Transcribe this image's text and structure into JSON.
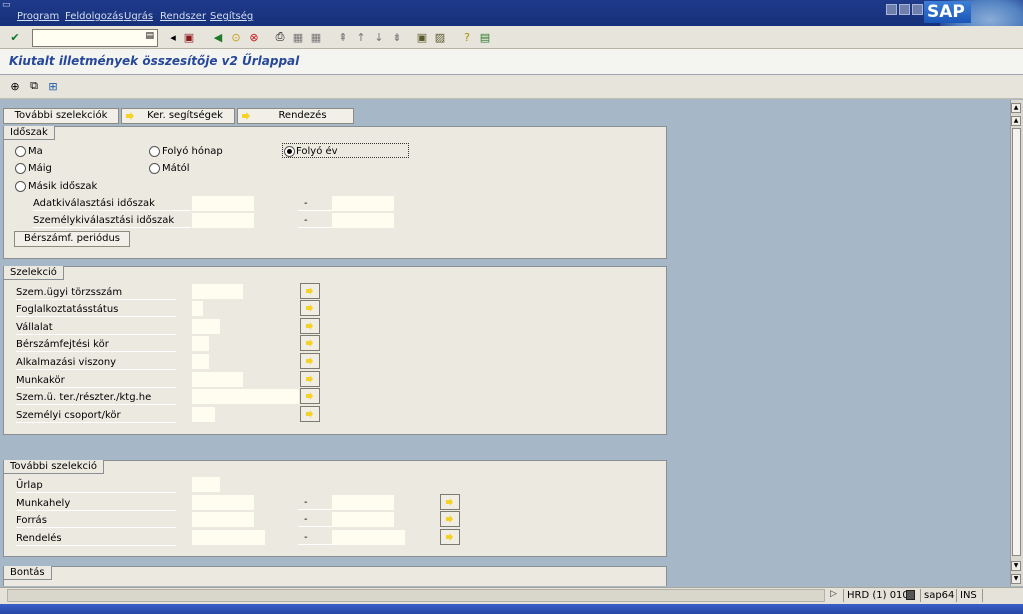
{
  "menu": {
    "items": [
      "Program",
      "Feldolgozás",
      "Ugrás",
      "Rendszer",
      "Segítség"
    ]
  },
  "brand": {
    "logo_text": "SAP"
  },
  "title": "Kiutalt illetmények összesítője v2 Űrlappal",
  "tabs_buttons": {
    "more_selections": "További szelekciók",
    "search_help": "Ker. segítségek",
    "sort": "Rendezés"
  },
  "period": {
    "frame_title": "Időszak",
    "radio_today": "Ma",
    "radio_current_month": "Folyó hónap",
    "radio_current_year": "Folyó év",
    "radio_until": "Máig",
    "radio_from": "Mától",
    "radio_other": "Másik időszak",
    "selected": "Folyó év",
    "data_period_label": "Adatkiválasztási időszak",
    "person_period_label": "Személykiválasztási időszak",
    "dash": "-",
    "payroll_period_button": "Bérszámf. periódus"
  },
  "selection": {
    "frame_title": "Szelekció",
    "fields": [
      "Szem.ügyi törzsszám",
      "Foglalkoztatásstátus",
      "Vállalat",
      "Bérszámfejtési kör",
      "Alkalmazási viszony",
      "Munkakör",
      "Szem.ü. ter./részter./ktg.he",
      "Személyi csoport/kör"
    ]
  },
  "more": {
    "frame_title": "További szelekció",
    "form_label": "Űrlap",
    "workplace_label": "Munkahely",
    "source_label": "Forrás",
    "order_label": "Rendelés",
    "dash": "-"
  },
  "breakdown": {
    "frame_title": "Bontás"
  },
  "status": {
    "system": "HRD (1) 010",
    "server": "sap64",
    "mode": "INS"
  },
  "colors": {
    "menubar": "#1f3a8a",
    "background": "#a6b7c8",
    "frame": "#ece9e1",
    "input": "#fffcf0",
    "title": "#26489a"
  }
}
